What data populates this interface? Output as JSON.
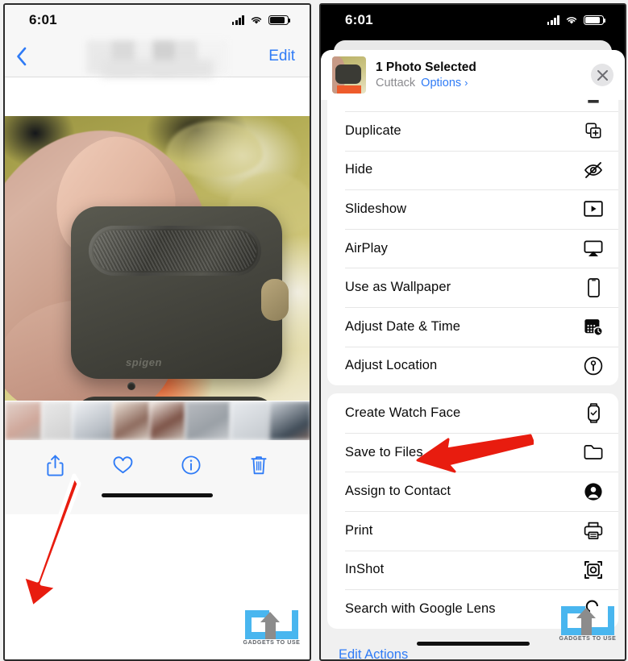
{
  "left_phone": {
    "status_bar": {
      "time": "6:01",
      "cellular_icon": "cellular-signal-icon",
      "wifi_icon": "wifi-icon",
      "battery_icon": "battery-icon"
    },
    "nav_bar": {
      "back_icon": "back-chevron-icon",
      "title": "",
      "edit_label": "Edit"
    },
    "photo": {
      "alt_text": "Hand holding dark green Spigen AirPods Pro case",
      "brand_text": "spigen"
    },
    "toolbar": {
      "share_label": "share-icon",
      "favorite_label": "heart-icon",
      "info_label": "info-icon",
      "delete_label": "trash-icon"
    },
    "arrow": {
      "color": "#e81c0f",
      "points_to": "share-button"
    },
    "watermark": {
      "text": "GADGETS TO USE",
      "color": "#49b6ef"
    }
  },
  "right_phone": {
    "status_bar": {
      "time": "6:01",
      "cellular_icon": "cellular-signal-icon",
      "wifi_icon": "wifi-icon",
      "battery_icon": "battery-icon"
    },
    "share_sheet": {
      "header": {
        "title": "1 Photo Selected",
        "place": "Cuttack",
        "options_label": "Options",
        "chevron": "›",
        "close_icon": "close-icon",
        "thumbnail": "selected-photo-thumbnail"
      },
      "groups": [
        {
          "name": "actions-group-1",
          "items": [
            {
              "label": "Duplicate",
              "icon": "duplicate-icon"
            },
            {
              "label": "Hide",
              "icon": "eye-slash-icon"
            },
            {
              "label": "Slideshow",
              "icon": "slideshow-play-icon"
            },
            {
              "label": "AirPlay",
              "icon": "airplay-icon"
            },
            {
              "label": "Use as Wallpaper",
              "icon": "iphone-icon"
            },
            {
              "label": "Adjust Date & Time",
              "icon": "calendar-clock-icon"
            },
            {
              "label": "Adjust Location",
              "icon": "location-pin-circle-icon"
            }
          ]
        },
        {
          "name": "actions-group-2",
          "items": [
            {
              "label": "Create Watch Face",
              "icon": "apple-watch-icon"
            },
            {
              "label": "Save to Files",
              "icon": "folder-icon"
            },
            {
              "label": "Assign to Contact",
              "icon": "person-circle-icon"
            },
            {
              "label": "Print",
              "icon": "printer-icon"
            },
            {
              "label": "InShot",
              "icon": "inshot-app-icon"
            },
            {
              "label": "Search with Google Lens",
              "icon": "google-lens-search-icon"
            }
          ]
        }
      ],
      "edit_actions_label": "Edit Actions"
    },
    "arrow": {
      "color": "#e81c0f",
      "points_to": "Save to Files"
    },
    "watermark": {
      "text": "GADGETS TO USE",
      "color": "#49b6ef"
    }
  }
}
